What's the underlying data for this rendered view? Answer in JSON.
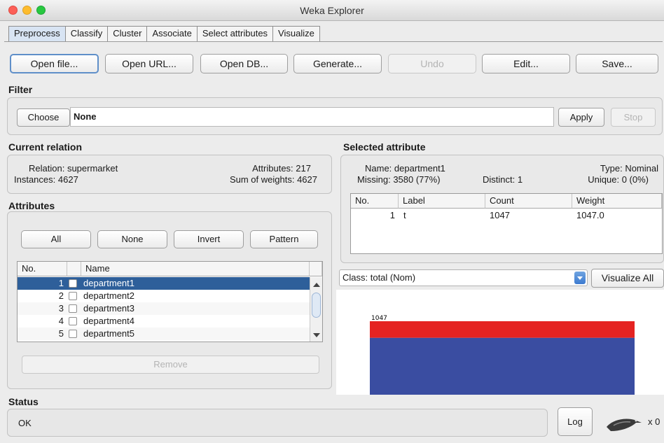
{
  "window": {
    "title": "Weka Explorer"
  },
  "tabs": [
    "Preprocess",
    "Classify",
    "Cluster",
    "Associate",
    "Select attributes",
    "Visualize"
  ],
  "toolbar": {
    "open_file": "Open file...",
    "open_url": "Open URL...",
    "open_db": "Open DB...",
    "generate": "Generate...",
    "undo": "Undo",
    "edit": "Edit...",
    "save": "Save..."
  },
  "filter": {
    "heading": "Filter",
    "choose": "Choose",
    "value": "None",
    "apply": "Apply",
    "stop": "Stop"
  },
  "relation": {
    "heading": "Current relation",
    "relation_label": "Relation:",
    "relation_value": "supermarket",
    "instances_label": "Instances:",
    "instances_value": "4627",
    "attributes_label": "Attributes:",
    "attributes_value": "217",
    "sum_weights_label": "Sum of weights:",
    "sum_weights_value": "4627"
  },
  "attributes": {
    "heading": "Attributes",
    "btn_all": "All",
    "btn_none": "None",
    "btn_invert": "Invert",
    "btn_pattern": "Pattern",
    "col_no": "No.",
    "col_name": "Name",
    "rows": [
      {
        "no": "1",
        "name": "department1",
        "selected": true
      },
      {
        "no": "2",
        "name": "department2",
        "selected": false
      },
      {
        "no": "3",
        "name": "department3",
        "selected": false
      },
      {
        "no": "4",
        "name": "department4",
        "selected": false
      },
      {
        "no": "5",
        "name": "department5",
        "selected": false
      }
    ],
    "remove": "Remove"
  },
  "selected_attribute": {
    "heading": "Selected attribute",
    "name_label": "Name:",
    "name_value": "department1",
    "missing_label": "Missing:",
    "missing_value": "3580 (77%)",
    "distinct_label": "Distinct:",
    "distinct_value": "1",
    "type_label": "Type:",
    "type_value": "Nominal",
    "unique_label": "Unique:",
    "unique_value": "0 (0%)",
    "columns": [
      "No.",
      "Label",
      "Count",
      "Weight"
    ],
    "rows": [
      {
        "no": "1",
        "label": "t",
        "count": "1047",
        "weight": "1047.0"
      }
    ]
  },
  "class_selector": {
    "value": "Class: total (Nom)",
    "visualize_all": "Visualize All"
  },
  "chart_data": {
    "type": "bar",
    "categories": [
      "t"
    ],
    "series": [
      {
        "values": [
          1047
        ],
        "color": "#e52321"
      },
      {
        "values": [
          3580
        ],
        "color": "#3a4da1"
      }
    ],
    "data_labels": [
      "1047"
    ]
  },
  "status": {
    "heading": "Status",
    "message": "OK",
    "log": "Log",
    "count": "x 0"
  },
  "colors": {
    "selection": "#2e5f9a",
    "accent_border": "#5f8fc9",
    "bar_red": "#e52321",
    "bar_blue": "#3a4da1"
  }
}
